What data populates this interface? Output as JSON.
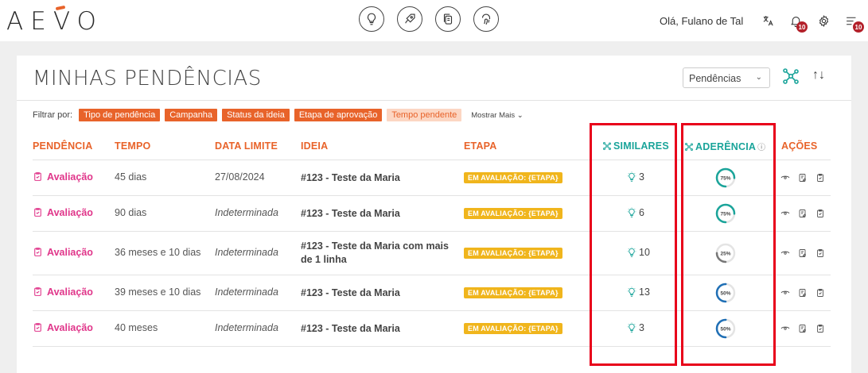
{
  "brand": {
    "logo_text": "AEVO"
  },
  "header": {
    "nav_icons": [
      "lightbulb-icon",
      "rocket-icon",
      "copy-icon",
      "fingerprint-icon"
    ],
    "greeting": "Olá, Fulano de Tal",
    "notifications_count": "10",
    "menu_count": "10"
  },
  "page": {
    "title": "MINHAS PENDÊNCIAS",
    "select_value": "Pendências"
  },
  "filters": {
    "label": "Filtrar por:",
    "chips": [
      "Tipo de pendência",
      "Campanha",
      "Status da ideia",
      "Etapa de aprovação",
      "Tempo pendente"
    ],
    "more": "Mostrar Mais"
  },
  "table": {
    "headers": {
      "pendencia": "PENDÊNCIA",
      "tempo": "TEMPO",
      "data_limite": "DATA LIMITE",
      "ideia": "IDEIA",
      "etapa": "ETAPA",
      "similares": "SIMILARES",
      "aderencia": "ADERÊNCIA",
      "acoes": "AÇÕES"
    },
    "rows": [
      {
        "pendencia": "Avaliação",
        "tempo": "45 dias",
        "data_limite": "27/08/2024",
        "ideia": "#123 - Teste da Maria",
        "ideia2": "",
        "etapa": "EM AVALIAÇÃO: {ETAPA}",
        "similares": "3",
        "aderencia": "75%",
        "aderencia_value": 0.75,
        "color": "#1aa49a"
      },
      {
        "pendencia": "Avaliação",
        "tempo": "90 dias",
        "data_limite": "Indeterminada",
        "ideia": "#123 - Teste da Maria",
        "ideia2": "",
        "etapa": "EM AVALIAÇÃO: {ETAPA}",
        "similares": "6",
        "aderencia": "75%",
        "aderencia_value": 0.75,
        "color": "#1aa49a"
      },
      {
        "pendencia": "Avaliação",
        "tempo": "36 meses e 10 dias",
        "data_limite": "Indeterminada",
        "ideia": "#123 - Teste da Maria com mais",
        "ideia2": "de 1 linha",
        "etapa": "EM AVALIAÇÃO: {ETAPA}",
        "similares": "10",
        "aderencia": "25%",
        "aderencia_value": 0.25,
        "color": "#777777"
      },
      {
        "pendencia": "Avaliação",
        "tempo": "39 meses e 10 dias",
        "data_limite": "Indeterminada",
        "ideia": "#123 - Teste da Maria",
        "ideia2": "",
        "etapa": "EM AVALIAÇÃO: {ETAPA}",
        "similares": "13",
        "aderencia": "50%",
        "aderencia_value": 0.5,
        "color": "#1f6fb5"
      },
      {
        "pendencia": "Avaliação",
        "tempo": "40 meses",
        "data_limite": "Indeterminada",
        "ideia": "#123 - Teste da Maria",
        "ideia2": "",
        "etapa": "EM AVALIAÇÃO: {ETAPA}",
        "similares": "3",
        "aderencia": "50%",
        "aderencia_value": 0.5,
        "color": "#1f6fb5"
      }
    ]
  },
  "colors": {
    "accent": "#e8632a",
    "teal": "#1aa49a",
    "pink": "#e0368a",
    "etapa": "#f0b51c",
    "highlight": "#e8001a"
  }
}
